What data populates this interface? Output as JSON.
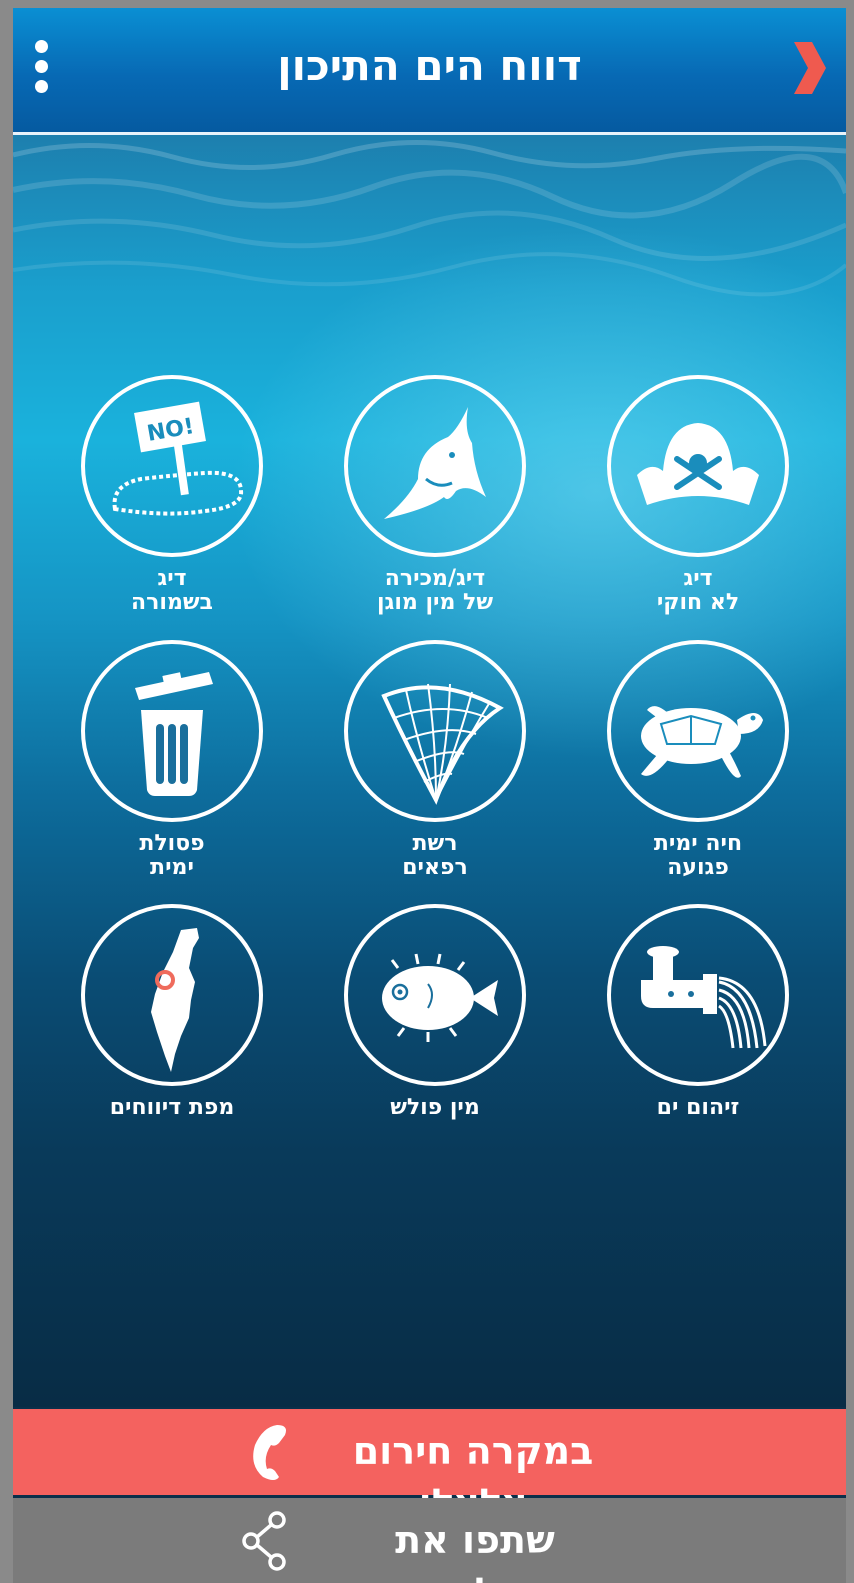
{
  "header": {
    "title": "דווח הים התיכון",
    "menu_icon": "kebab-menu-icon",
    "back_icon": "chevron-right-icon"
  },
  "tiles": [
    {
      "label": "דיג\nלא חוקי",
      "icon": "pirate-hat-icon"
    },
    {
      "label": "דיג/מכירה\nשל מין מוגן",
      "icon": "shark-icon"
    },
    {
      "label": "דיג\nבשמורה",
      "icon": "no-sign-reserve-icon"
    },
    {
      "label": "חיה ימית\nפגועה",
      "icon": "sea-turtle-icon"
    },
    {
      "label": "רשת\nרפאים",
      "icon": "fishing-net-icon"
    },
    {
      "label": "פסולת\nימית",
      "icon": "trash-bin-icon"
    },
    {
      "label": "זיהום ים",
      "icon": "sewage-pipe-icon"
    },
    {
      "label": "מין פולש",
      "icon": "pufferfish-icon"
    },
    {
      "label": "מפת דיווחים",
      "icon": "israel-map-icon"
    }
  ],
  "emergency": {
    "label": "במקרה חירום צלצלו",
    "icon": "phone-icon",
    "color": "#f4625f"
  },
  "share": {
    "label": "שתפו את האפליקציה",
    "icon": "share-icon",
    "color": "#7b7b7b"
  },
  "colors": {
    "header_top": "#0a8fd3",
    "header_bottom": "#055aa0",
    "accent_red": "#f4625f"
  }
}
